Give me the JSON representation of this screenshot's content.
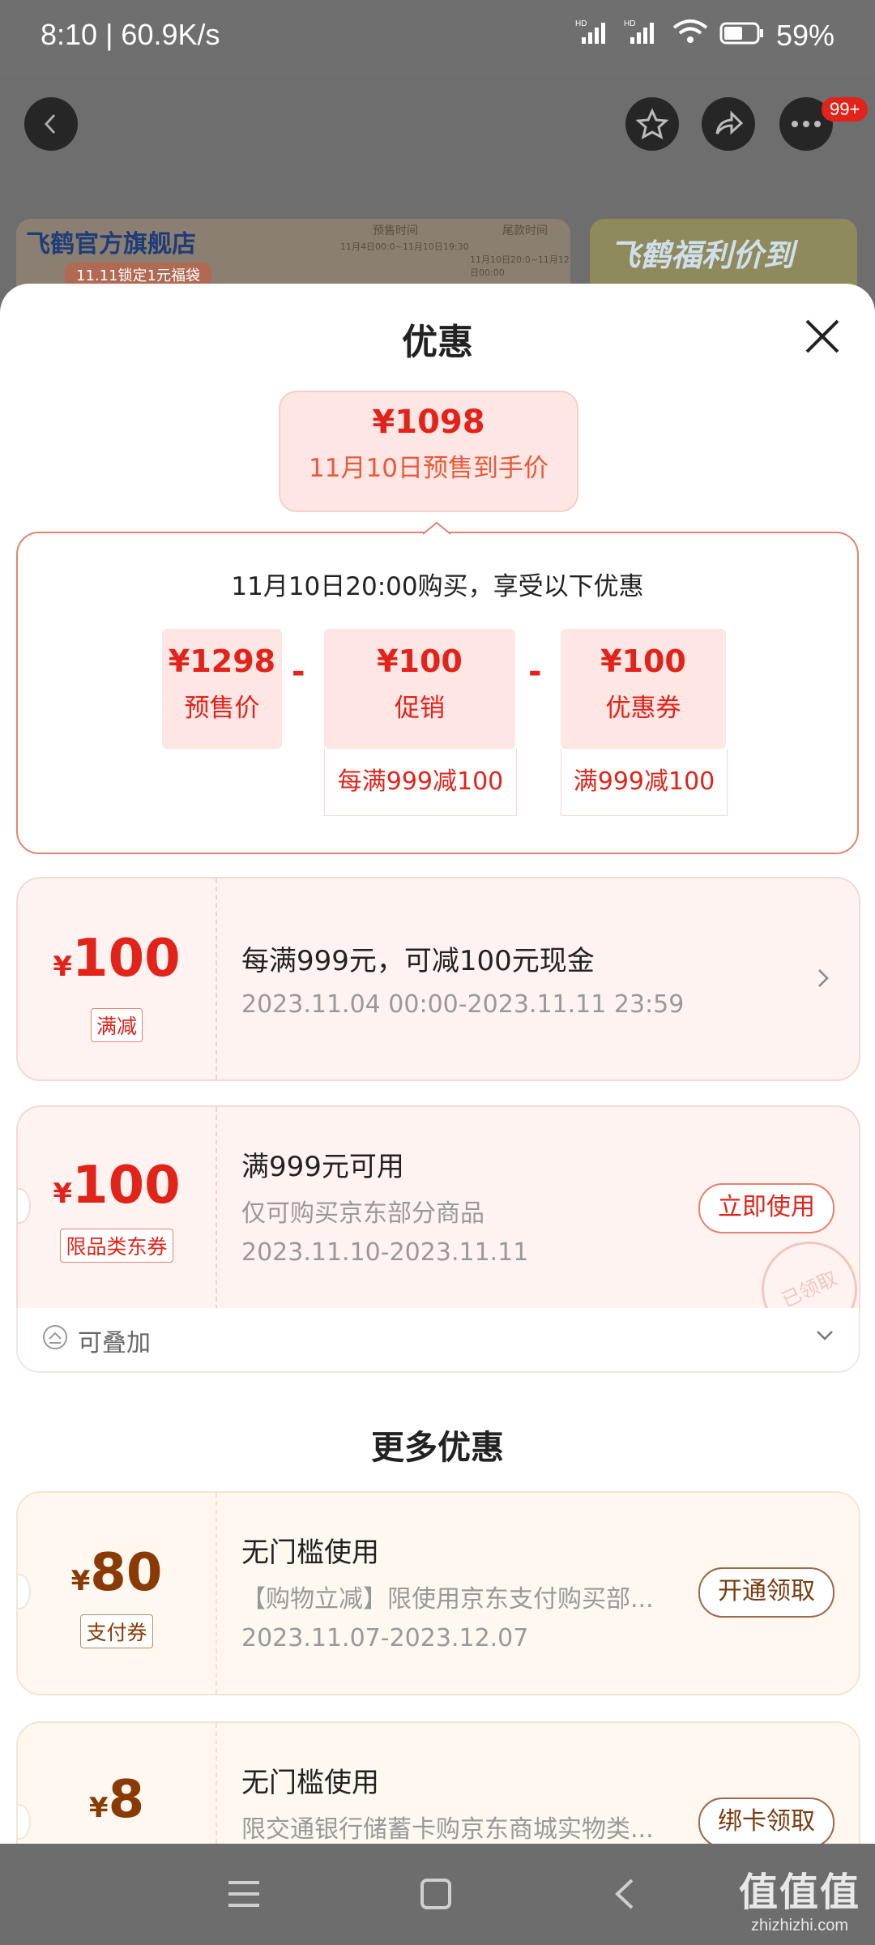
{
  "status_bar": {
    "time": "8:10 | 60.9K/s",
    "hd1": "HD",
    "hd2": "HD",
    "battery": "59%"
  },
  "top_bar": {
    "badge": "99+"
  },
  "banner": {
    "store": "飞鹤官方旗舰店",
    "promo": "11.11锁定1元福袋",
    "presale_time": "预售时间",
    "final_time": "尾款时间",
    "range1": "11月4日00:0~11月10日19:30",
    "range2": "11月10日20:0~11月12日00:00",
    "right_title": "飞鹤福利价到"
  },
  "sheet": {
    "title": "优惠",
    "final_price": "¥1098",
    "final_price_label": "11月10日预售到手价",
    "calc_title": "11月10日20:00购买，享受以下优惠",
    "calc": [
      {
        "value": "¥1298",
        "label": "预售价",
        "sub": ""
      },
      {
        "value": "¥100",
        "label": "促销",
        "sub": "每满999减100"
      },
      {
        "value": "¥100",
        "label": "优惠券",
        "sub": "满999减100"
      }
    ],
    "minus": "-"
  },
  "coupons": [
    {
      "yen": "¥",
      "amount": "100",
      "tag": "满减",
      "title": "每满999元，可减100元现金",
      "desc": "",
      "date": "2023.11.04 00:00-2023.11.11 23:59",
      "button": ""
    },
    {
      "yen": "¥",
      "amount": "100",
      "tag": "限品类东券",
      "title": "满999元可用",
      "desc": "仅可购买京东部分商品",
      "date": "2023.11.10-2023.11.11",
      "button": "立即使用",
      "stamp": "已领取"
    }
  ],
  "stack_label": "可叠加",
  "more_title": "更多优惠",
  "more_coupons": [
    {
      "yen": "¥",
      "amount": "80",
      "tag": "支付券",
      "title": "无门槛使用",
      "desc": "【购物立减】限使用京东支付购买部...",
      "date": "2023.11.07-2023.12.07",
      "button": "开通领取"
    },
    {
      "yen": "¥",
      "amount": "8",
      "tag": "",
      "title": "无门槛使用",
      "desc": "限交通银行储蓄卡购京东商城实物类...",
      "date": "",
      "button": "绑卡领取"
    }
  ],
  "watermark": {
    "big": "值值值",
    "small": "zhizhizhi.com"
  },
  "icons": [
    "back-icon",
    "star-icon",
    "share-icon",
    "more-icon",
    "close-icon",
    "chevron-right-icon",
    "chevron-down-icon",
    "stack-icon",
    "menu-icon",
    "home-icon",
    "nav-back-icon"
  ]
}
